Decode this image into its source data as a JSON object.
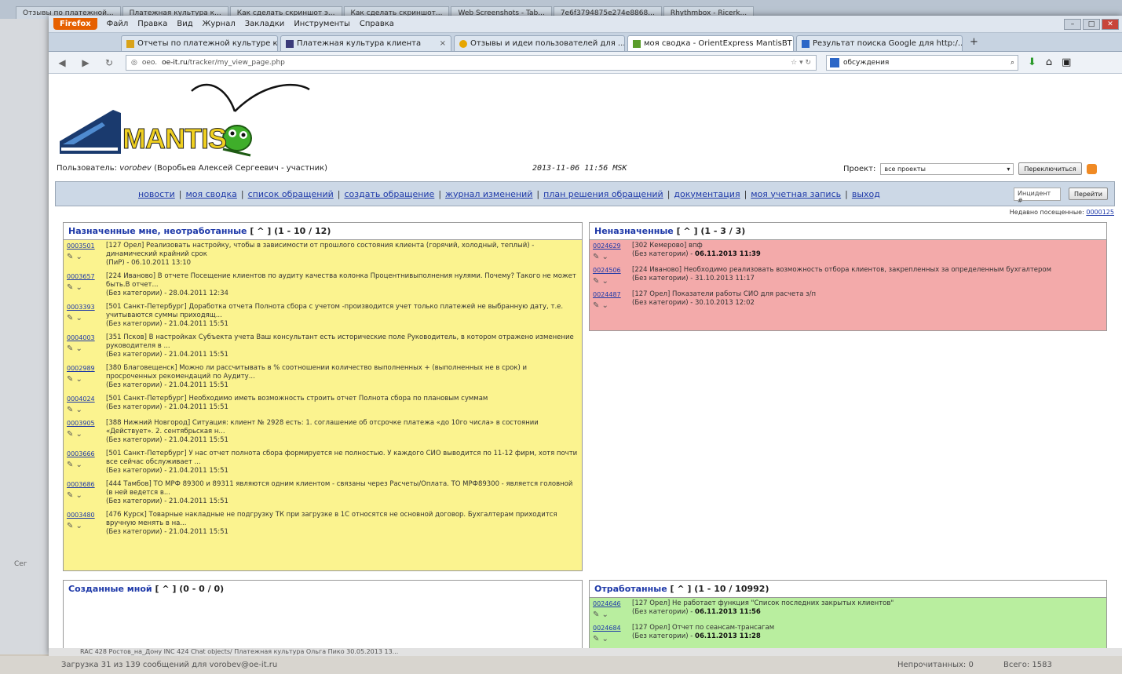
{
  "background_tabs": [
    "Отзывы по платежной...",
    "Платежная культура к...",
    "Как сделать скриншот э...",
    "Как сделать скриншот...",
    "Web Screenshots - Tab...",
    "7e6f3794875e274e8868...",
    "Rhythmbox - Ricerk..."
  ],
  "left_label": "Сег",
  "menu": {
    "app": "Firefox",
    "items": [
      "Файл",
      "Правка",
      "Вид",
      "Журнал",
      "Закладки",
      "Инструменты",
      "Справка"
    ]
  },
  "tabs": [
    {
      "label": "Отчеты по платежной культуре кл...",
      "color": "#d9a31a"
    },
    {
      "label": "Платежная культура клиента",
      "color": "#3b3b7a"
    },
    {
      "label": "Отзывы и идеи пользователей для ...",
      "color": "#e6a600"
    },
    {
      "label": "моя сводка - OrientExpress MantisBT",
      "color": "#5a9d2a",
      "active": true
    },
    {
      "label": "Результат поиска Google для http:/...",
      "color": "#2b66c7"
    }
  ],
  "nav": {
    "url_prefix": "oeo.",
    "url_host": "oe-it.ru",
    "url_path": "/tracker/my_view_page.php",
    "search_text": "обсуждения"
  },
  "logo": {
    "text": "MANTIS"
  },
  "user": {
    "label": "Пользователь:",
    "name": "vorobev",
    "fullname": "(Воробьев Алексей Сергеевич - участник)",
    "datetime": "2013-11-06 11:56 MSK",
    "project_label": "Проект:",
    "project_value": "все проекты",
    "switch_button": "Переключиться"
  },
  "links": [
    "новости",
    "моя сводка",
    "список обращений",
    "создать обращение",
    "журнал изменений",
    "план решения обращений",
    "документация",
    "моя учетная запись",
    "выход"
  ],
  "id_search": {
    "placeholder": "Инцидент #",
    "button": "Перейти"
  },
  "recent": {
    "label": "Недавно посещенные:",
    "value": "0000125"
  },
  "assigned": {
    "title": "Назначенные мне, неотработанные",
    "bracket": "[ ^ ]",
    "count": "(1 - 10 / 12)",
    "items": [
      {
        "id": "0003501",
        "text": "[127 Орел] Реализовать настройку, чтобы в зависимости от прошлого состояния клиента (горячий, холодный, теплый) - динамический крайний срок",
        "meta": "(ПиР) - 06.10.2011 13:10"
      },
      {
        "id": "0003657",
        "text": "[224 Иваново] В отчете Посещение клиентов по аудиту качества колонка Процентнивыполнения нулями. Почему? Такого не может быть.В отчет...",
        "meta": "(Без категории) - 28.04.2011 12:34"
      },
      {
        "id": "0003393",
        "text": "[501 Санкт-Петербург] Доработка отчета Полнота сбора с учетом -производится учет только платежей не выбранную дату, т.е. учитываются суммы приходящ...",
        "meta": "(Без категории) - 21.04.2011 15:51"
      },
      {
        "id": "0004003",
        "text": "[351 Псков] В настройках Субъекта учета Ваш консультант есть исторические поле Руководитель, в котором отражено изменение руководителя в ...",
        "meta": "(Без категории) - 21.04.2011 15:51"
      },
      {
        "id": "0002989",
        "text": "[380 Благовещенск] Можно ли рассчитывать в % соотношении количество выполненных + (выполненных не в срок) и просроченных рекомендаций по Аудиту...",
        "meta": "(Без категории) - 21.04.2011 15:51"
      },
      {
        "id": "0004024",
        "text": "[501 Санкт-Петербург] Необходимо иметь возможность строить отчет Полнота сбора по плановым суммам",
        "meta": "(Без категории) - 21.04.2011 15:51"
      },
      {
        "id": "0003905",
        "text": "[388 Нижний Новгород] Ситуация: клиент № 2928 есть: 1. соглашение об отсрочке платежа «до 10го числа» в состоянии «Действует». 2. сентябрьская н...",
        "meta": "(Без категории) - 21.04.2011 15:51"
      },
      {
        "id": "0003666",
        "text": "[501 Санкт-Петербург] У нас отчет полнота сбора формируется не полностью. У каждого СИО выводится по 11-12 фирм, хотя почти все сейчас обслуживает ...",
        "meta": "(Без категории) - 21.04.2011 15:51"
      },
      {
        "id": "0003686",
        "text": "[444 Тамбов] ТО МРФ 89300 и 89311 являются одним клиентом - связаны через Расчеты/Оплата. ТО МРФ89300 - является головной (в ней ведется в...",
        "meta": "(Без категории) - 21.04.2011 15:51"
      },
      {
        "id": "0003480",
        "text": "[476 Курск] Товарные накладные не подгрузку ТК при загрузке в 1С относятся не основной договор. Бухгалтерам приходится вручную менять в на...",
        "meta": "(Без категории) - 21.04.2011 15:51"
      }
    ]
  },
  "unassigned": {
    "title": "Неназначенные",
    "bracket": "[ ^ ]",
    "count": "(1 - 3 / 3)",
    "items": [
      {
        "id": "0024629",
        "text": "[302 Кемерово] впф",
        "meta": "(Без категории) - ",
        "date": "06.11.2013 11:39"
      },
      {
        "id": "0024506",
        "text": "[224 Иваново] Необходимо реализовать возможность отбора клиентов, закрепленных за определенным бухгалтером",
        "meta": "(Без категории) - 31.10.2013 11:17",
        "date": ""
      },
      {
        "id": "0024487",
        "text": "[127 Орел] Показатели работы СИО для расчета з/п",
        "meta": "(Без категории) - 30.10.2013 12:02",
        "date": ""
      }
    ]
  },
  "created": {
    "title": "Созданные мной",
    "bracket": "[ ^ ]",
    "count": "(0 - 0 / 0)"
  },
  "resolved": {
    "title": "Отработанные",
    "bracket": "[ ^ ]",
    "count": "(1 - 10 / 10992)",
    "items": [
      {
        "id": "0024646",
        "text": "[127 Орел] Не работает функция \"Список последних закрытых клиентов\"",
        "meta": "(Без категории) - ",
        "date": "06.11.2013 11:56"
      },
      {
        "id": "0024684",
        "text": "[127 Орел] Отчет по сеансам-трансагам",
        "meta": "(Без категории) - ",
        "date": "06.11.2013 11:28"
      }
    ]
  },
  "bottom_strip": "RAC 428 Ростов_на_Дону     INC 424 Chat objects/ Платежная культура     Ольга Пико     30.05.2013 13...",
  "statusbar": {
    "left": "Загрузка 31 из 139 сообщений для vorobev@oe-it.ru",
    "unread": "Непрочитанных: 0",
    "total": "Всего: 1583"
  }
}
